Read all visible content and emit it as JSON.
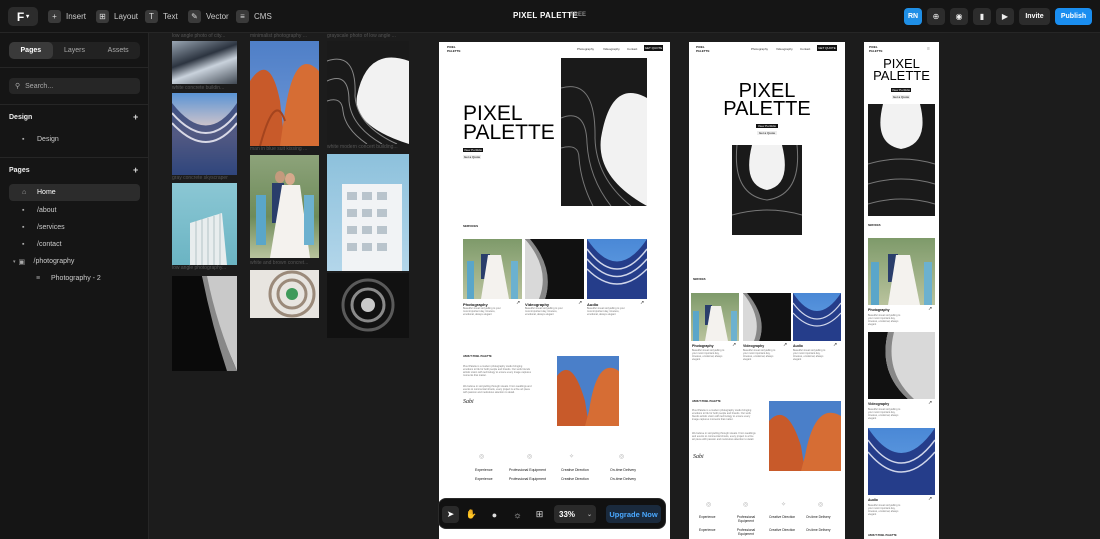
{
  "topbar": {
    "logo_icon": "framer-logo-icon",
    "tools": [
      {
        "icon": "plus-icon",
        "label": "Insert"
      },
      {
        "icon": "layout-icon",
        "label": "Layout"
      },
      {
        "icon": "text-icon",
        "label": "Text"
      },
      {
        "icon": "vector-icon",
        "label": "Vector"
      },
      {
        "icon": "cms-icon",
        "label": "CMS"
      }
    ],
    "project_title": "PIXEL PALETTE",
    "plan_badge": "FREE",
    "avatar": "RN",
    "invite_label": "Invite",
    "publish_label": "Publish"
  },
  "left_panel": {
    "tabs": [
      "Pages",
      "Layers",
      "Assets"
    ],
    "active_tab": "Pages",
    "search_placeholder": "Search...",
    "design_section": {
      "title": "Design",
      "items": [
        "Design"
      ]
    },
    "pages_section": {
      "title": "Pages",
      "items": [
        {
          "label": "Home",
          "active": true
        },
        {
          "label": "/about"
        },
        {
          "label": "/services"
        },
        {
          "label": "/contact"
        },
        {
          "label": "/photography"
        },
        {
          "label": "Photography - 2"
        }
      ]
    }
  },
  "canvas": {
    "photo_captions": [
      "low angle photo of city...",
      "minimalist photography ...",
      "grayscale photo of low angle ...",
      "white concrete buildin...",
      "man in blue suit kissing ...",
      "white modern concert building...",
      "gray concrete skyscraper",
      "low angle photography...",
      "white and brown concret..."
    ],
    "site": {
      "nav_links": [
        "Photography",
        "Videography",
        "Contact"
      ],
      "nav_cta": "GET QUOTE",
      "logo_line1": "PIXEL",
      "logo_line2": "PALETTE",
      "hero_line1": "PIXEL",
      "hero_line2": "PALETTE",
      "hero_button": "View Portfolio",
      "hero_button2": "Get a Quote",
      "services_heading": "SERVICES",
      "services": [
        {
          "title": "Photography",
          "desc": "Beautiful visual storytelling to your most important day, timeless, emotional, always elegant"
        },
        {
          "title": "Videography",
          "desc": "Beautiful visual storytelling to your most important day, timeless, emotional, always elegant"
        },
        {
          "title": "Audio",
          "desc": "Beautiful visual storytelling to your most important day, timeless, emotional, always elegant"
        }
      ],
      "about_heading": "ABOUT PIXEL PALETTE",
      "about_text": "Pixel Palette is a modern photography studio bringing emotions to life for both people and brands. Our work blends artistic vision with technology to ensure every image captures moments that matter.",
      "about_text2": "We believe in storytelling through visuals. From weddings and events to commercial shoots, every project is a fine art piece with passion and meticulous attention to detail.",
      "signature": "Sabi",
      "features": [
        "Experience",
        "Professional Equipment",
        "Creative Direction",
        "On-time Delivery"
      ],
      "features_row2": [
        "Experience",
        "Professional Equipment",
        "Creative Direction",
        "On-time Delivery"
      ]
    }
  },
  "bottom_toolbar": {
    "tools": [
      "cursor-icon",
      "hand-icon",
      "comment-icon",
      "sun-icon",
      "grid-icon"
    ],
    "zoom": "33%",
    "upgrade_label": "Upgrade Now"
  }
}
